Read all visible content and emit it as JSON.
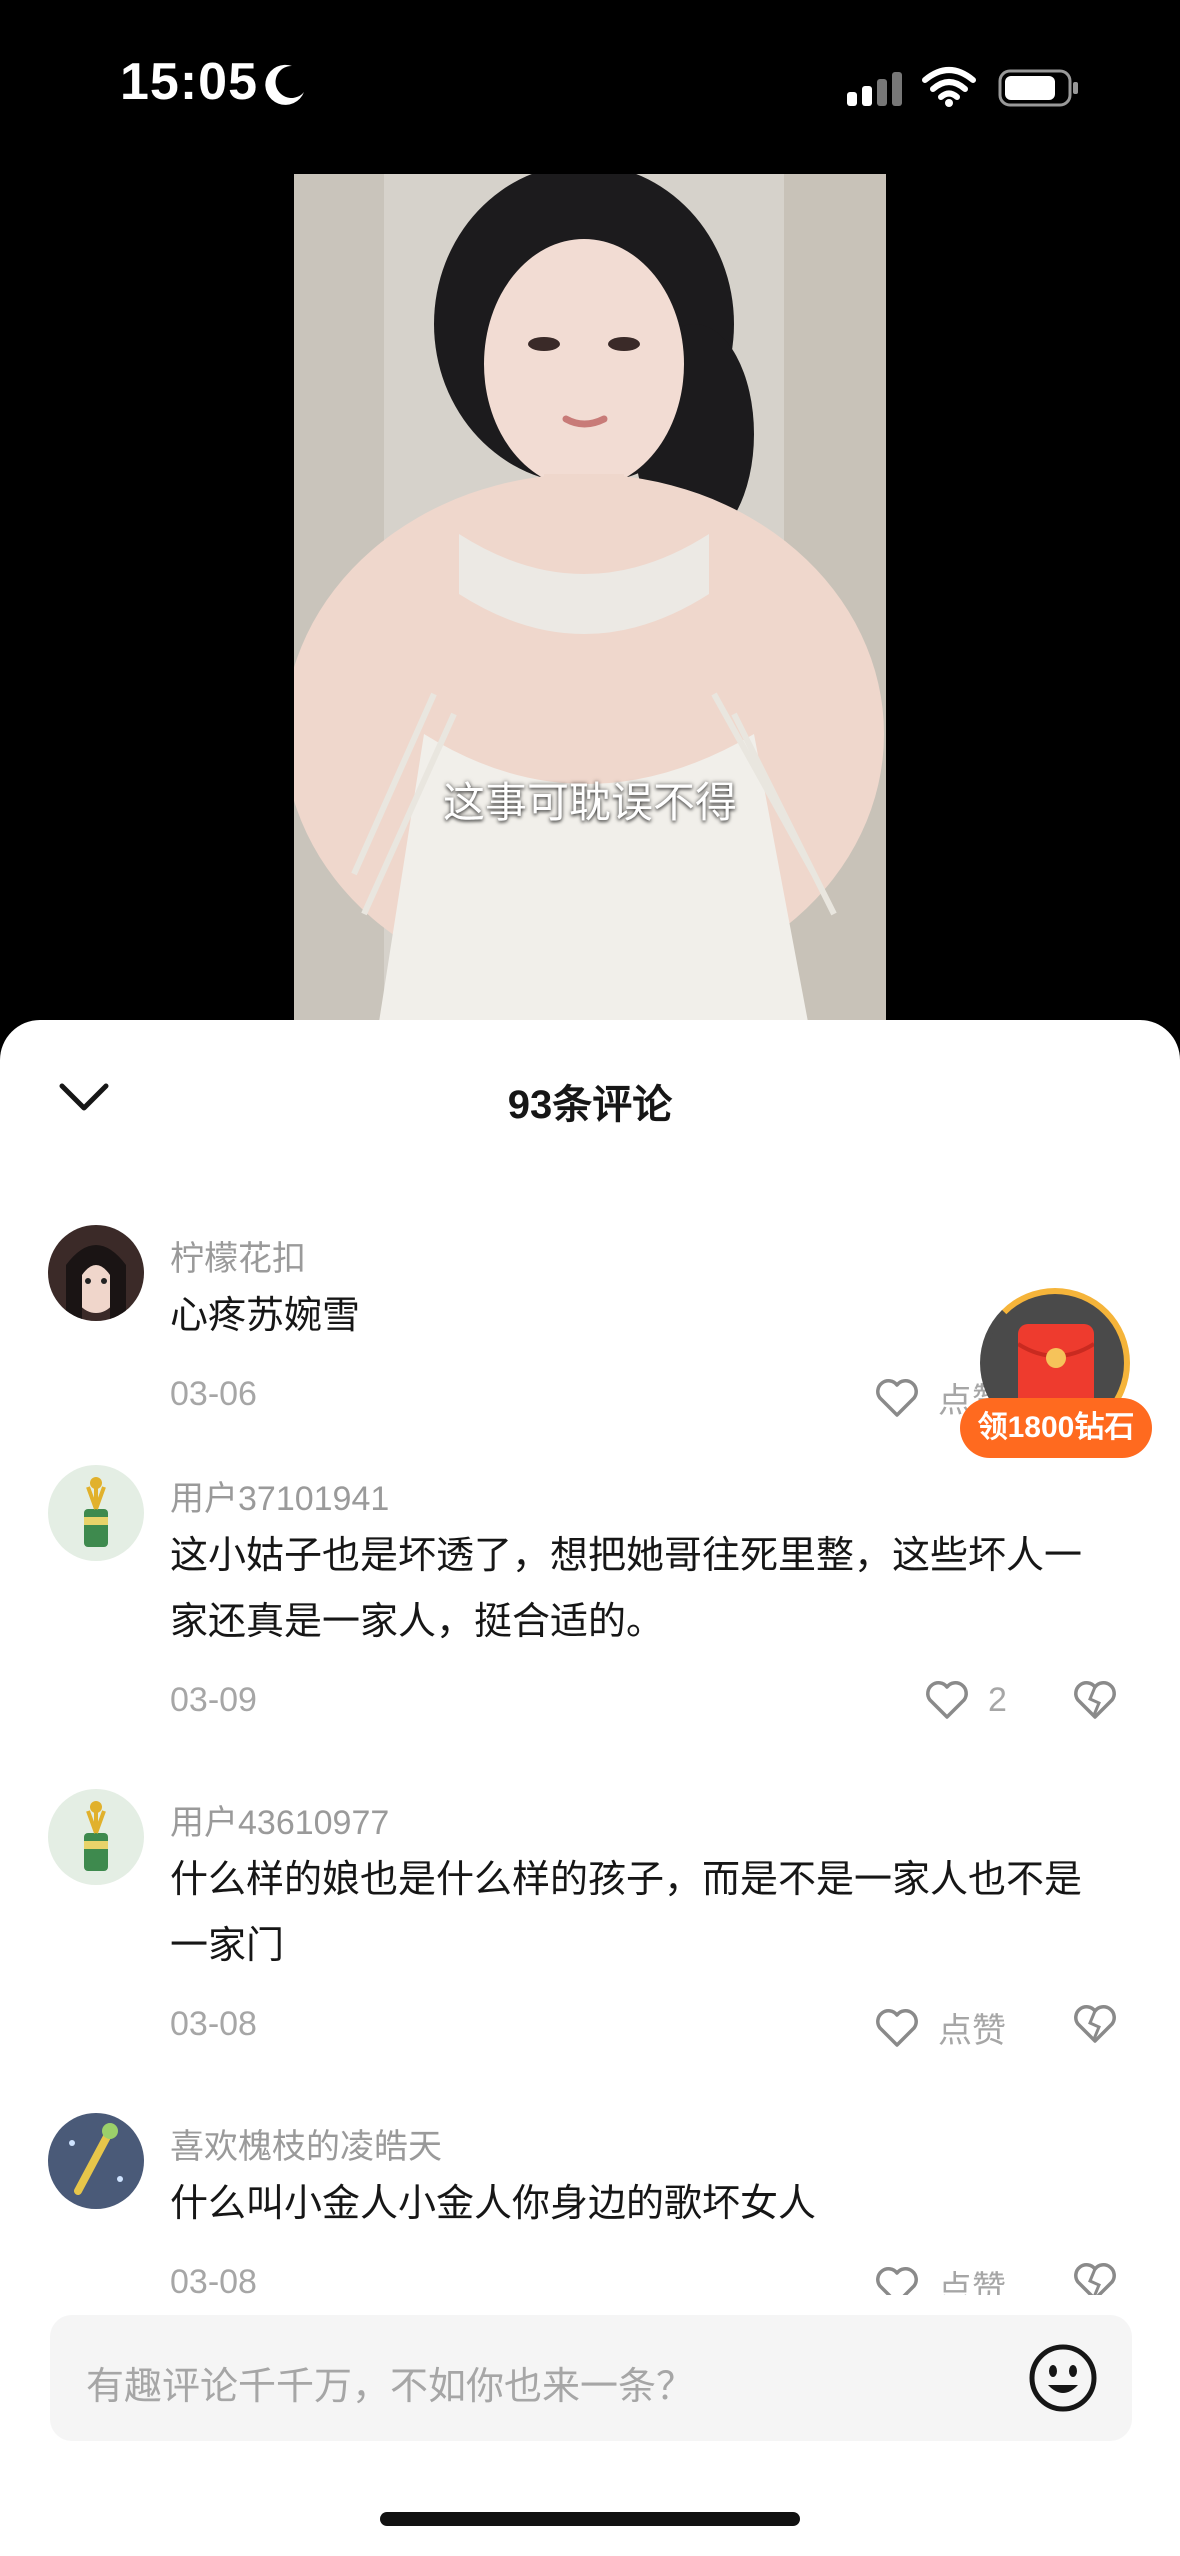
{
  "status_bar": {
    "time": "15:05"
  },
  "video": {
    "subtitle": "这事可耽误不得"
  },
  "comments_header": {
    "title": "93条评论"
  },
  "comments": [
    {
      "username": "柠檬花扣",
      "text": "心疼苏婉雪",
      "date": "03-06",
      "likes": "点赞"
    },
    {
      "username": "用户37101941",
      "text": "这小姑子也是坏透了，想把她哥往死里整，这些坏人一家还真是一家人，挺合适的。",
      "date": "03-09",
      "likes": "2"
    },
    {
      "username": "用户43610977",
      "text": "什么样的娘也是什么样的孩子，而是不是一家人也不是一家门",
      "date": "03-08",
      "likes": "点赞"
    },
    {
      "username": "喜欢槐枝的凌皓天",
      "text": "什么叫小金人小金人你身边的歌坏女人",
      "date": "03-08",
      "likes": "点赞"
    }
  ],
  "reward": {
    "label": "领1800钻石"
  },
  "input": {
    "placeholder": "有趣评论千千万，不如你也来一条？"
  },
  "colors": {
    "accent": "#ff6a1f",
    "text_primary": "#161616",
    "text_secondary": "#a6a6a6"
  }
}
